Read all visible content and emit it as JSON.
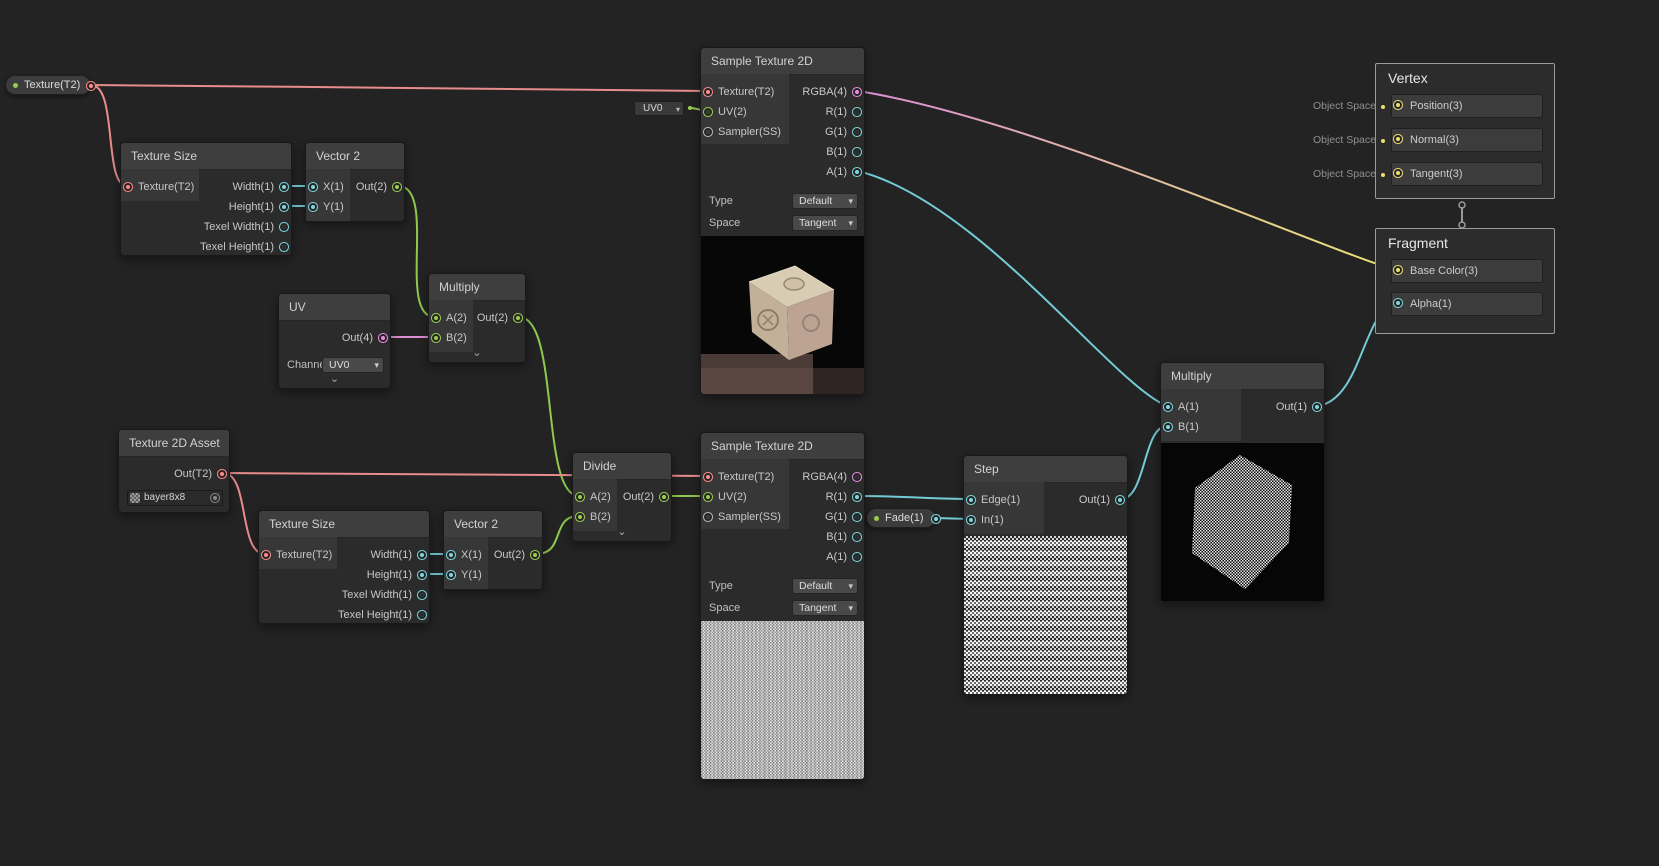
{
  "icons": {
    "caret": "▾",
    "chevron": "⌄"
  },
  "colors": {
    "texture2d": "#FF8B8B",
    "float1": "#7FD6DE",
    "vector2": "#9CCE4F",
    "vector3_yellow": "#E9E470",
    "vector4": "#E98CE0",
    "wire_texture": "#E88C8C",
    "wire_float": "#74CBD6",
    "wire_vector2": "#8FC94F",
    "wire_vector4": "#DD8FD5",
    "stack_connector": "#9A9A9A"
  },
  "properties": {
    "texture": {
      "label": "Texture(T2)"
    },
    "fade": {
      "label": "Fade(1)"
    }
  },
  "uv0_default": {
    "value": "UV0"
  },
  "nodes": {
    "texture_size_1": {
      "title": "Texture Size",
      "inputs": [
        "Texture(T2)"
      ],
      "outputs": [
        "Width(1)",
        "Height(1)",
        "Texel Width(1)",
        "Texel Height(1)"
      ]
    },
    "vector2_1": {
      "title": "Vector 2",
      "inputs": [
        "X(1)",
        "Y(1)"
      ],
      "outputs": [
        "Out(2)"
      ]
    },
    "multiply_1": {
      "title": "Multiply",
      "inputs": [
        "A(2)",
        "B(2)"
      ],
      "outputs": [
        "Out(2)"
      ]
    },
    "uv": {
      "title": "UV",
      "outputs": [
        "Out(4)"
      ],
      "channel_label": "Channel",
      "channel_value": "UV0"
    },
    "sample_top": {
      "title": "Sample Texture 2D",
      "inputs": [
        "Texture(T2)",
        "UV(2)",
        "Sampler(SS)"
      ],
      "outputs": [
        "RGBA(4)",
        "R(1)",
        "G(1)",
        "B(1)",
        "A(1)"
      ],
      "type_label": "Type",
      "type_value": "Default",
      "space_label": "Space",
      "space_value": "Tangent"
    },
    "texture_asset": {
      "title": "Texture 2D Asset",
      "outputs": [
        "Out(T2)"
      ],
      "asset": "bayer8x8"
    },
    "texture_size_2": {
      "title": "Texture Size",
      "inputs": [
        "Texture(T2)"
      ],
      "outputs": [
        "Width(1)",
        "Height(1)",
        "Texel Width(1)",
        "Texel Height(1)"
      ]
    },
    "vector2_2": {
      "title": "Vector 2",
      "inputs": [
        "X(1)",
        "Y(1)"
      ],
      "outputs": [
        "Out(2)"
      ]
    },
    "divide": {
      "title": "Divide",
      "inputs": [
        "A(2)",
        "B(2)"
      ],
      "outputs": [
        "Out(2)"
      ]
    },
    "sample_bottom": {
      "title": "Sample Texture 2D",
      "inputs": [
        "Texture(T2)",
        "UV(2)",
        "Sampler(SS)"
      ],
      "outputs": [
        "RGBA(4)",
        "R(1)",
        "G(1)",
        "B(1)",
        "A(1)"
      ],
      "type_label": "Type",
      "type_value": "Default",
      "space_label": "Space",
      "space_value": "Tangent"
    },
    "step": {
      "title": "Step",
      "inputs": [
        "Edge(1)",
        "In(1)"
      ],
      "outputs": [
        "Out(1)"
      ]
    },
    "multiply_2": {
      "title": "Multiply",
      "inputs": [
        "A(1)",
        "B(1)"
      ],
      "outputs": [
        "Out(1)"
      ]
    }
  },
  "stack": {
    "vertex": {
      "title": "Vertex",
      "rows": [
        {
          "space": "Object Space",
          "label": "Position(3)"
        },
        {
          "space": "Object Space",
          "label": "Normal(3)"
        },
        {
          "space": "Object Space",
          "label": "Tangent(3)"
        }
      ]
    },
    "fragment": {
      "title": "Fragment",
      "rows": [
        {
          "label": "Base Color(3)"
        },
        {
          "label": "Alpha(1)"
        }
      ]
    }
  }
}
